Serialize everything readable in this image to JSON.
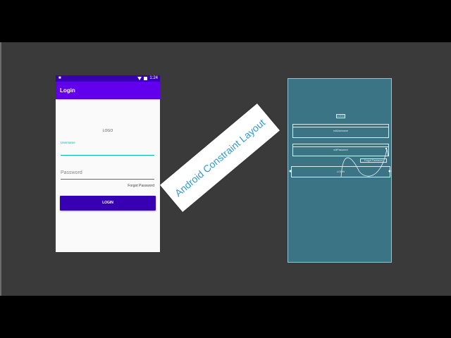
{
  "phone": {
    "status_time": "1:24",
    "app_title": "Login",
    "logo": "LOGO",
    "username_label": "Username",
    "password_placeholder": "Password",
    "forgot_password": "Forgot Password",
    "login_button": "LOGIN"
  },
  "banner": {
    "text": "Android Constraint Layout"
  },
  "blueprint": {
    "logo": "LOGO",
    "username": "edtUsername",
    "password": "edtPassword",
    "forgot": "Forgot Password",
    "login": "LOGIN"
  },
  "colors": {
    "status_bar": "#3700b3",
    "app_bar": "#6200ee",
    "accent": "#03b5aa",
    "button": "#3700b3",
    "blueprint_bg": "#3a7485",
    "banner_text": "#3399cc"
  }
}
